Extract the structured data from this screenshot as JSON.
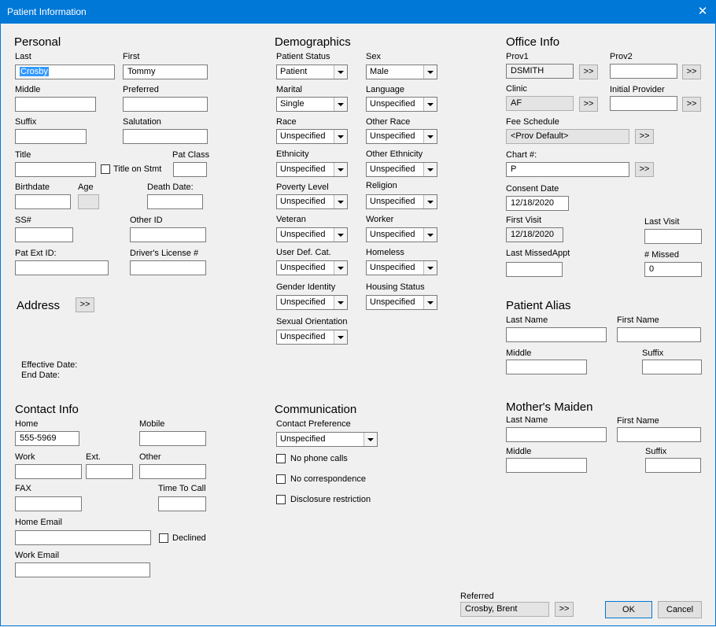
{
  "window": {
    "title": "Patient Information",
    "close_glyph": "✕"
  },
  "personal": {
    "heading": "Personal",
    "last_label": "Last",
    "last_value": "Crosby",
    "first_label": "First",
    "first_value": "Tommy",
    "middle_label": "Middle",
    "preferred_label": "Preferred",
    "suffix_label": "Suffix",
    "salutation_label": "Salutation",
    "title_label": "Title",
    "title_on_stmt_label": "Title on Stmt",
    "pat_class_label": "Pat Class",
    "birthdate_label": "Birthdate",
    "age_label": "Age",
    "death_date_label": "Death Date:",
    "ssn_label": "SS#",
    "other_id_label": "Other ID",
    "pat_ext_id_label": "Pat Ext ID:",
    "drivers_license_label": "Driver's License #"
  },
  "address": {
    "heading": "Address",
    "button": ">>",
    "effective_date_label": "Effective Date:",
    "end_date_label": "End Date:"
  },
  "demographics": {
    "heading": "Demographics",
    "patient_status_label": "Patient Status",
    "patient_status_value": "Patient",
    "sex_label": "Sex",
    "sex_value": "Male",
    "marital_label": "Marital",
    "marital_value": "Single",
    "language_label": "Language",
    "language_value": "Unspecified",
    "race_label": "Race",
    "race_value": "Unspecified",
    "other_race_label": "Other Race",
    "other_race_value": "Unspecified",
    "ethnicity_label": "Ethnicity",
    "ethnicity_value": "Unspecified",
    "other_ethnicity_label": "Other Ethnicity",
    "other_ethnicity_value": "Unspecified",
    "poverty_level_label": "Poverty Level",
    "poverty_level_value": "Unspecified",
    "religion_label": "Religion",
    "religion_value": "Unspecified",
    "veteran_label": "Veteran",
    "veteran_value": "Unspecified",
    "worker_label": "Worker",
    "worker_value": "Unspecified",
    "user_def_cat_label": "User Def. Cat.",
    "user_def_cat_value": "Unspecified",
    "homeless_label": "Homeless",
    "homeless_value": "Unspecified",
    "gender_identity_label": "Gender Identity",
    "gender_identity_value": "Unspecified",
    "housing_status_label": "Housing Status",
    "housing_status_value": "Unspecified",
    "sexual_orientation_label": "Sexual Orientation",
    "sexual_orientation_value": "Unspecified"
  },
  "office": {
    "heading": "Office Info",
    "prov1_label": "Prov1",
    "prov1_value": "DSMITH",
    "prov2_label": "Prov2",
    "clinic_label": "Clinic",
    "clinic_value": "AF",
    "initial_provider_label": "Initial Provider",
    "fee_schedule_label": "Fee Schedule",
    "fee_schedule_value": "<Prov Default>",
    "chart_label": "Chart #:",
    "chart_value": "P",
    "consent_date_label": "Consent Date",
    "consent_date_value": "12/18/2020",
    "first_visit_label": "First Visit",
    "first_visit_value": "12/18/2020",
    "last_visit_label": "Last Visit",
    "last_missed_label": "Last MissedAppt",
    "missed_label": "# Missed",
    "missed_value": "0",
    "pick_button": ">>"
  },
  "alias": {
    "heading": "Patient Alias",
    "last_name_label": "Last Name",
    "first_name_label": "First Name",
    "middle_label": "Middle",
    "suffix_label": "Suffix"
  },
  "maiden": {
    "heading": "Mother's Maiden",
    "last_name_label": "Last Name",
    "first_name_label": "First Name",
    "middle_label": "Middle",
    "suffix_label": "Suffix"
  },
  "contact": {
    "heading": "Contact Info",
    "home_label": "Home",
    "home_value": "555-5969",
    "mobile_label": "Mobile",
    "work_label": "Work",
    "ext_label": "Ext.",
    "other_label": "Other",
    "fax_label": "FAX",
    "time_to_call_label": "Time To Call",
    "home_email_label": "Home Email",
    "declined_label": "Declined",
    "work_email_label": "Work Email"
  },
  "communication": {
    "heading": "Communication",
    "contact_pref_label": "Contact Preference",
    "contact_pref_value": "Unspecified",
    "no_phone_label": "No phone calls",
    "no_corr_label": "No correspondence",
    "disclosure_label": "Disclosure restriction"
  },
  "footer": {
    "referred_label": "Referred",
    "referred_value": "Crosby, Brent",
    "referred_button": ">>",
    "ok_label": "OK",
    "cancel_label": "Cancel"
  }
}
